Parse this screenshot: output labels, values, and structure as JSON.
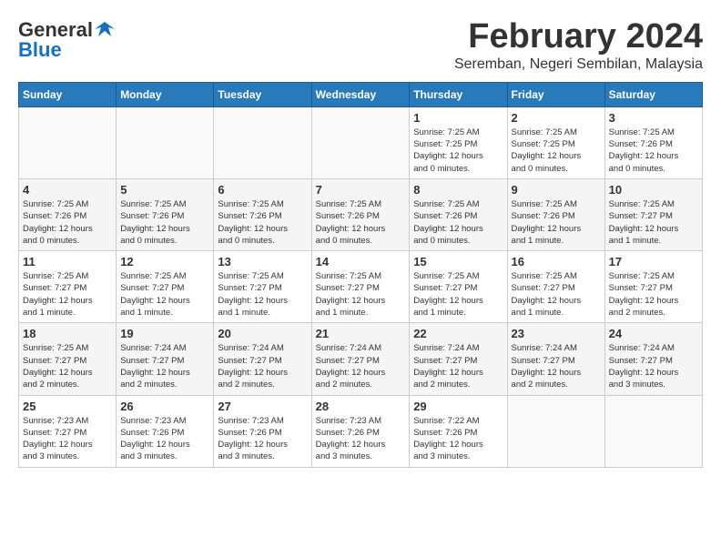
{
  "header": {
    "logo_general": "General",
    "logo_blue": "Blue",
    "month_title": "February 2024",
    "location": "Seremban, Negeri Sembilan, Malaysia"
  },
  "weekdays": [
    "Sunday",
    "Monday",
    "Tuesday",
    "Wednesday",
    "Thursday",
    "Friday",
    "Saturday"
  ],
  "weeks": [
    [
      {
        "day": "",
        "info": ""
      },
      {
        "day": "",
        "info": ""
      },
      {
        "day": "",
        "info": ""
      },
      {
        "day": "",
        "info": ""
      },
      {
        "day": "1",
        "info": "Sunrise: 7:25 AM\nSunset: 7:25 PM\nDaylight: 12 hours\nand 0 minutes."
      },
      {
        "day": "2",
        "info": "Sunrise: 7:25 AM\nSunset: 7:25 PM\nDaylight: 12 hours\nand 0 minutes."
      },
      {
        "day": "3",
        "info": "Sunrise: 7:25 AM\nSunset: 7:26 PM\nDaylight: 12 hours\nand 0 minutes."
      }
    ],
    [
      {
        "day": "4",
        "info": "Sunrise: 7:25 AM\nSunset: 7:26 PM\nDaylight: 12 hours\nand 0 minutes."
      },
      {
        "day": "5",
        "info": "Sunrise: 7:25 AM\nSunset: 7:26 PM\nDaylight: 12 hours\nand 0 minutes."
      },
      {
        "day": "6",
        "info": "Sunrise: 7:25 AM\nSunset: 7:26 PM\nDaylight: 12 hours\nand 0 minutes."
      },
      {
        "day": "7",
        "info": "Sunrise: 7:25 AM\nSunset: 7:26 PM\nDaylight: 12 hours\nand 0 minutes."
      },
      {
        "day": "8",
        "info": "Sunrise: 7:25 AM\nSunset: 7:26 PM\nDaylight: 12 hours\nand 0 minutes."
      },
      {
        "day": "9",
        "info": "Sunrise: 7:25 AM\nSunset: 7:26 PM\nDaylight: 12 hours\nand 1 minute."
      },
      {
        "day": "10",
        "info": "Sunrise: 7:25 AM\nSunset: 7:27 PM\nDaylight: 12 hours\nand 1 minute."
      }
    ],
    [
      {
        "day": "11",
        "info": "Sunrise: 7:25 AM\nSunset: 7:27 PM\nDaylight: 12 hours\nand 1 minute."
      },
      {
        "day": "12",
        "info": "Sunrise: 7:25 AM\nSunset: 7:27 PM\nDaylight: 12 hours\nand 1 minute."
      },
      {
        "day": "13",
        "info": "Sunrise: 7:25 AM\nSunset: 7:27 PM\nDaylight: 12 hours\nand 1 minute."
      },
      {
        "day": "14",
        "info": "Sunrise: 7:25 AM\nSunset: 7:27 PM\nDaylight: 12 hours\nand 1 minute."
      },
      {
        "day": "15",
        "info": "Sunrise: 7:25 AM\nSunset: 7:27 PM\nDaylight: 12 hours\nand 1 minute."
      },
      {
        "day": "16",
        "info": "Sunrise: 7:25 AM\nSunset: 7:27 PM\nDaylight: 12 hours\nand 1 minute."
      },
      {
        "day": "17",
        "info": "Sunrise: 7:25 AM\nSunset: 7:27 PM\nDaylight: 12 hours\nand 2 minutes."
      }
    ],
    [
      {
        "day": "18",
        "info": "Sunrise: 7:25 AM\nSunset: 7:27 PM\nDaylight: 12 hours\nand 2 minutes."
      },
      {
        "day": "19",
        "info": "Sunrise: 7:24 AM\nSunset: 7:27 PM\nDaylight: 12 hours\nand 2 minutes."
      },
      {
        "day": "20",
        "info": "Sunrise: 7:24 AM\nSunset: 7:27 PM\nDaylight: 12 hours\nand 2 minutes."
      },
      {
        "day": "21",
        "info": "Sunrise: 7:24 AM\nSunset: 7:27 PM\nDaylight: 12 hours\nand 2 minutes."
      },
      {
        "day": "22",
        "info": "Sunrise: 7:24 AM\nSunset: 7:27 PM\nDaylight: 12 hours\nand 2 minutes."
      },
      {
        "day": "23",
        "info": "Sunrise: 7:24 AM\nSunset: 7:27 PM\nDaylight: 12 hours\nand 2 minutes."
      },
      {
        "day": "24",
        "info": "Sunrise: 7:24 AM\nSunset: 7:27 PM\nDaylight: 12 hours\nand 3 minutes."
      }
    ],
    [
      {
        "day": "25",
        "info": "Sunrise: 7:23 AM\nSunset: 7:27 PM\nDaylight: 12 hours\nand 3 minutes."
      },
      {
        "day": "26",
        "info": "Sunrise: 7:23 AM\nSunset: 7:26 PM\nDaylight: 12 hours\nand 3 minutes."
      },
      {
        "day": "27",
        "info": "Sunrise: 7:23 AM\nSunset: 7:26 PM\nDaylight: 12 hours\nand 3 minutes."
      },
      {
        "day": "28",
        "info": "Sunrise: 7:23 AM\nSunset: 7:26 PM\nDaylight: 12 hours\nand 3 minutes."
      },
      {
        "day": "29",
        "info": "Sunrise: 7:22 AM\nSunset: 7:26 PM\nDaylight: 12 hours\nand 3 minutes."
      },
      {
        "day": "",
        "info": ""
      },
      {
        "day": "",
        "info": ""
      }
    ]
  ]
}
